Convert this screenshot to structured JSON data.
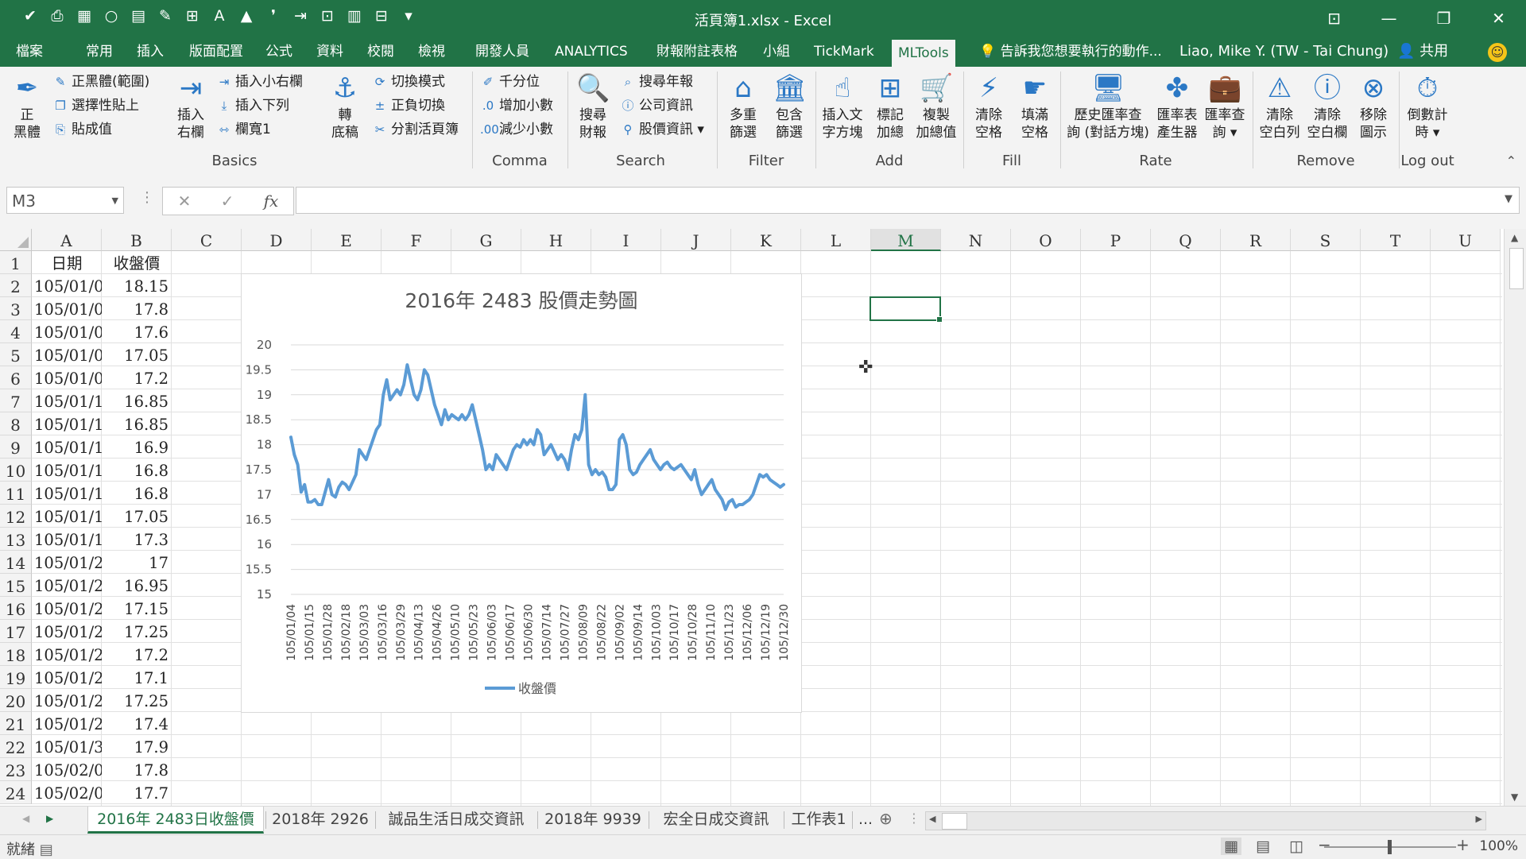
{
  "window": {
    "title": "活頁簿1.xlsx - Excel",
    "controls": [
      "⊡",
      "—",
      "❐",
      "✕"
    ]
  },
  "qat": [
    "✔",
    "⎙",
    "▦",
    "○",
    "▤",
    "✎",
    "⊞",
    "A",
    "▲",
    "❜",
    "⇥",
    "⊡",
    "▥",
    "⊟",
    "▾"
  ],
  "menu_tabs": [
    "檔案",
    "常用",
    "插入",
    "版面配置",
    "公式",
    "資料",
    "校閱",
    "檢視",
    "開發人員",
    "ANALYTICS",
    "財報附註表格",
    "小組",
    "TickMark",
    "MLTools"
  ],
  "active_tab": "MLTools",
  "tell_me": "告訴我您想要執行的動作...",
  "user": "Liao, Mike Y. (TW - Tai Chung)",
  "share": "共用",
  "ribbon": {
    "basics_big": [
      "正",
      "黑體"
    ],
    "basics_small": [
      "正黑體(範圍)",
      "選擇性貼上",
      "貼成值"
    ],
    "insert_big": [
      "插入",
      "右欄"
    ],
    "insert_small": [
      "插入小右欄",
      "插入下列",
      "欄寬1"
    ],
    "draft_big": [
      "轉",
      "底稿"
    ],
    "mode_small": [
      "切換模式",
      "正負切換",
      "分割活頁簿"
    ],
    "comma_small": [
      "千分位",
      "增加小數",
      "減少小數"
    ],
    "search_big": [
      "搜尋",
      "財報"
    ],
    "search_small": [
      "搜尋年報",
      "公司資訊",
      "股價資訊"
    ],
    "filter_1": [
      "多重",
      "篩選"
    ],
    "filter_2": [
      "包含",
      "篩選"
    ],
    "add_1": [
      "插入文",
      "字方塊"
    ],
    "add_2": [
      "標記",
      "加總"
    ],
    "add_3": [
      "複製",
      "加總值"
    ],
    "fill_1": [
      "清除",
      "空格"
    ],
    "fill_2": [
      "填滿",
      "空格"
    ],
    "rate_1": [
      "歷史匯率查",
      "詢 (對話方塊)"
    ],
    "rate_2": [
      "匯率表",
      "產生器"
    ],
    "rate_3": [
      "匯率查",
      "詢"
    ],
    "remove_1": [
      "清除",
      "空白列"
    ],
    "remove_2": [
      "清除",
      "空白欄"
    ],
    "remove_3": [
      "移除",
      "圖示"
    ],
    "logout_1": [
      "倒數計",
      "時"
    ],
    "groups": [
      "Basics",
      "Comma",
      "Search",
      "Filter",
      "Add",
      "Fill",
      "Rate",
      "Remove",
      "Log out"
    ]
  },
  "formula_bar": {
    "name_box": "M3",
    "fx": "fx",
    "cancel": "✕",
    "enter": "✓",
    "formula": ""
  },
  "columns": [
    "A",
    "B",
    "C",
    "D",
    "E",
    "F",
    "G",
    "H",
    "I",
    "J",
    "K",
    "L",
    "M",
    "N",
    "O",
    "P",
    "Q",
    "R",
    "S",
    "T",
    "U"
  ],
  "selected_column": "M",
  "rows": [
    "1",
    "2",
    "3",
    "4",
    "5",
    "6",
    "7",
    "8",
    "9",
    "10",
    "11",
    "12",
    "13",
    "14",
    "15",
    "16",
    "17",
    "18",
    "19",
    "20",
    "21",
    "22",
    "23",
    "24"
  ],
  "cells": {
    "A": [
      "日期",
      "105/01/0",
      "105/01/0",
      "105/01/0",
      "105/01/0",
      "105/01/0",
      "105/01/1",
      "105/01/1",
      "105/01/1",
      "105/01/1",
      "105/01/1",
      "105/01/1",
      "105/01/1",
      "105/01/2",
      "105/01/2",
      "105/01/2",
      "105/01/2",
      "105/01/2",
      "105/01/2",
      "105/01/2",
      "105/01/2",
      "105/01/3",
      "105/02/0",
      "105/02/0"
    ],
    "B": [
      "收盤價",
      "18.15",
      "17.8",
      "17.6",
      "17.05",
      "17.2",
      "16.85",
      "16.85",
      "16.9",
      "16.8",
      "16.8",
      "17.05",
      "17.3",
      "17",
      "16.95",
      "17.15",
      "17.25",
      "17.2",
      "17.1",
      "17.25",
      "17.4",
      "17.9",
      "17.8",
      "17.7"
    ]
  },
  "chart_data": {
    "type": "line",
    "title": "2016年 2483 股價走勢圖",
    "ylim": [
      15,
      20
    ],
    "yticks": [
      "20",
      "19.5",
      "19",
      "18.5",
      "18",
      "17.5",
      "17",
      "16.5",
      "16",
      "15.5",
      "15"
    ],
    "xticks": [
      "105/01/04",
      "105/01/15",
      "105/01/28",
      "105/02/18",
      "105/03/03",
      "105/03/16",
      "105/03/29",
      "105/04/13",
      "105/04/26",
      "105/05/10",
      "105/05/23",
      "105/06/03",
      "105/06/17",
      "105/06/30",
      "105/07/14",
      "105/07/27",
      "105/08/09",
      "105/08/22",
      "105/09/02",
      "105/09/14",
      "105/10/03",
      "105/10/17",
      "105/10/28",
      "105/11/10",
      "105/11/23",
      "105/12/06",
      "105/12/19",
      "105/12/30"
    ],
    "series": [
      {
        "name": "收盤價",
        "color": "#5b9bd5",
        "values": [
          18.15,
          17.8,
          17.6,
          17.05,
          17.2,
          16.85,
          16.85,
          16.9,
          16.8,
          16.8,
          17.05,
          17.3,
          17.0,
          16.95,
          17.15,
          17.25,
          17.2,
          17.1,
          17.25,
          17.4,
          17.9,
          17.8,
          17.7,
          17.9,
          18.1,
          18.3,
          18.4,
          19.0,
          19.3,
          18.9,
          19.0,
          19.1,
          19.0,
          19.2,
          19.6,
          19.3,
          19.0,
          18.9,
          19.1,
          19.5,
          19.4,
          19.1,
          18.8,
          18.6,
          18.4,
          18.7,
          18.5,
          18.6,
          18.55,
          18.5,
          18.6,
          18.5,
          18.6,
          18.8,
          18.5,
          18.2,
          17.9,
          17.5,
          17.6,
          17.5,
          17.8,
          17.7,
          17.6,
          17.5,
          17.7,
          17.9,
          18.0,
          17.95,
          18.1,
          18.0,
          18.1,
          18.0,
          18.3,
          18.2,
          17.8,
          17.9,
          18.0,
          17.85,
          17.7,
          17.8,
          17.7,
          17.5,
          17.9,
          18.2,
          18.1,
          18.3,
          19.0,
          17.6,
          17.4,
          17.5,
          17.4,
          17.45,
          17.35,
          17.1,
          17.1,
          17.2,
          18.1,
          18.2,
          18.0,
          17.5,
          17.4,
          17.45,
          17.6,
          17.7,
          17.8,
          17.9,
          17.7,
          17.6,
          17.5,
          17.6,
          17.65,
          17.55,
          17.5,
          17.55,
          17.6,
          17.5,
          17.4,
          17.3,
          17.5,
          17.2,
          17.0,
          17.1,
          17.2,
          17.3,
          17.1,
          17.0,
          16.9,
          16.7,
          16.85,
          16.9,
          16.75,
          16.8,
          16.8,
          16.85,
          16.9,
          17.0,
          17.2,
          17.4,
          17.35,
          17.4,
          17.3,
          17.25,
          17.2,
          17.15,
          17.2
        ]
      }
    ],
    "legend": "bottom",
    "grid": true
  },
  "sheets": [
    "2016年 2483日收盤價",
    "2018年 2926",
    "誠品生活日成交資訊",
    "2018年 9939",
    "宏全日成交資訊",
    "工作表1",
    "..."
  ],
  "active_sheet": "2016年 2483日收盤價",
  "status": {
    "text": "就緒",
    "zoom": "100%"
  }
}
